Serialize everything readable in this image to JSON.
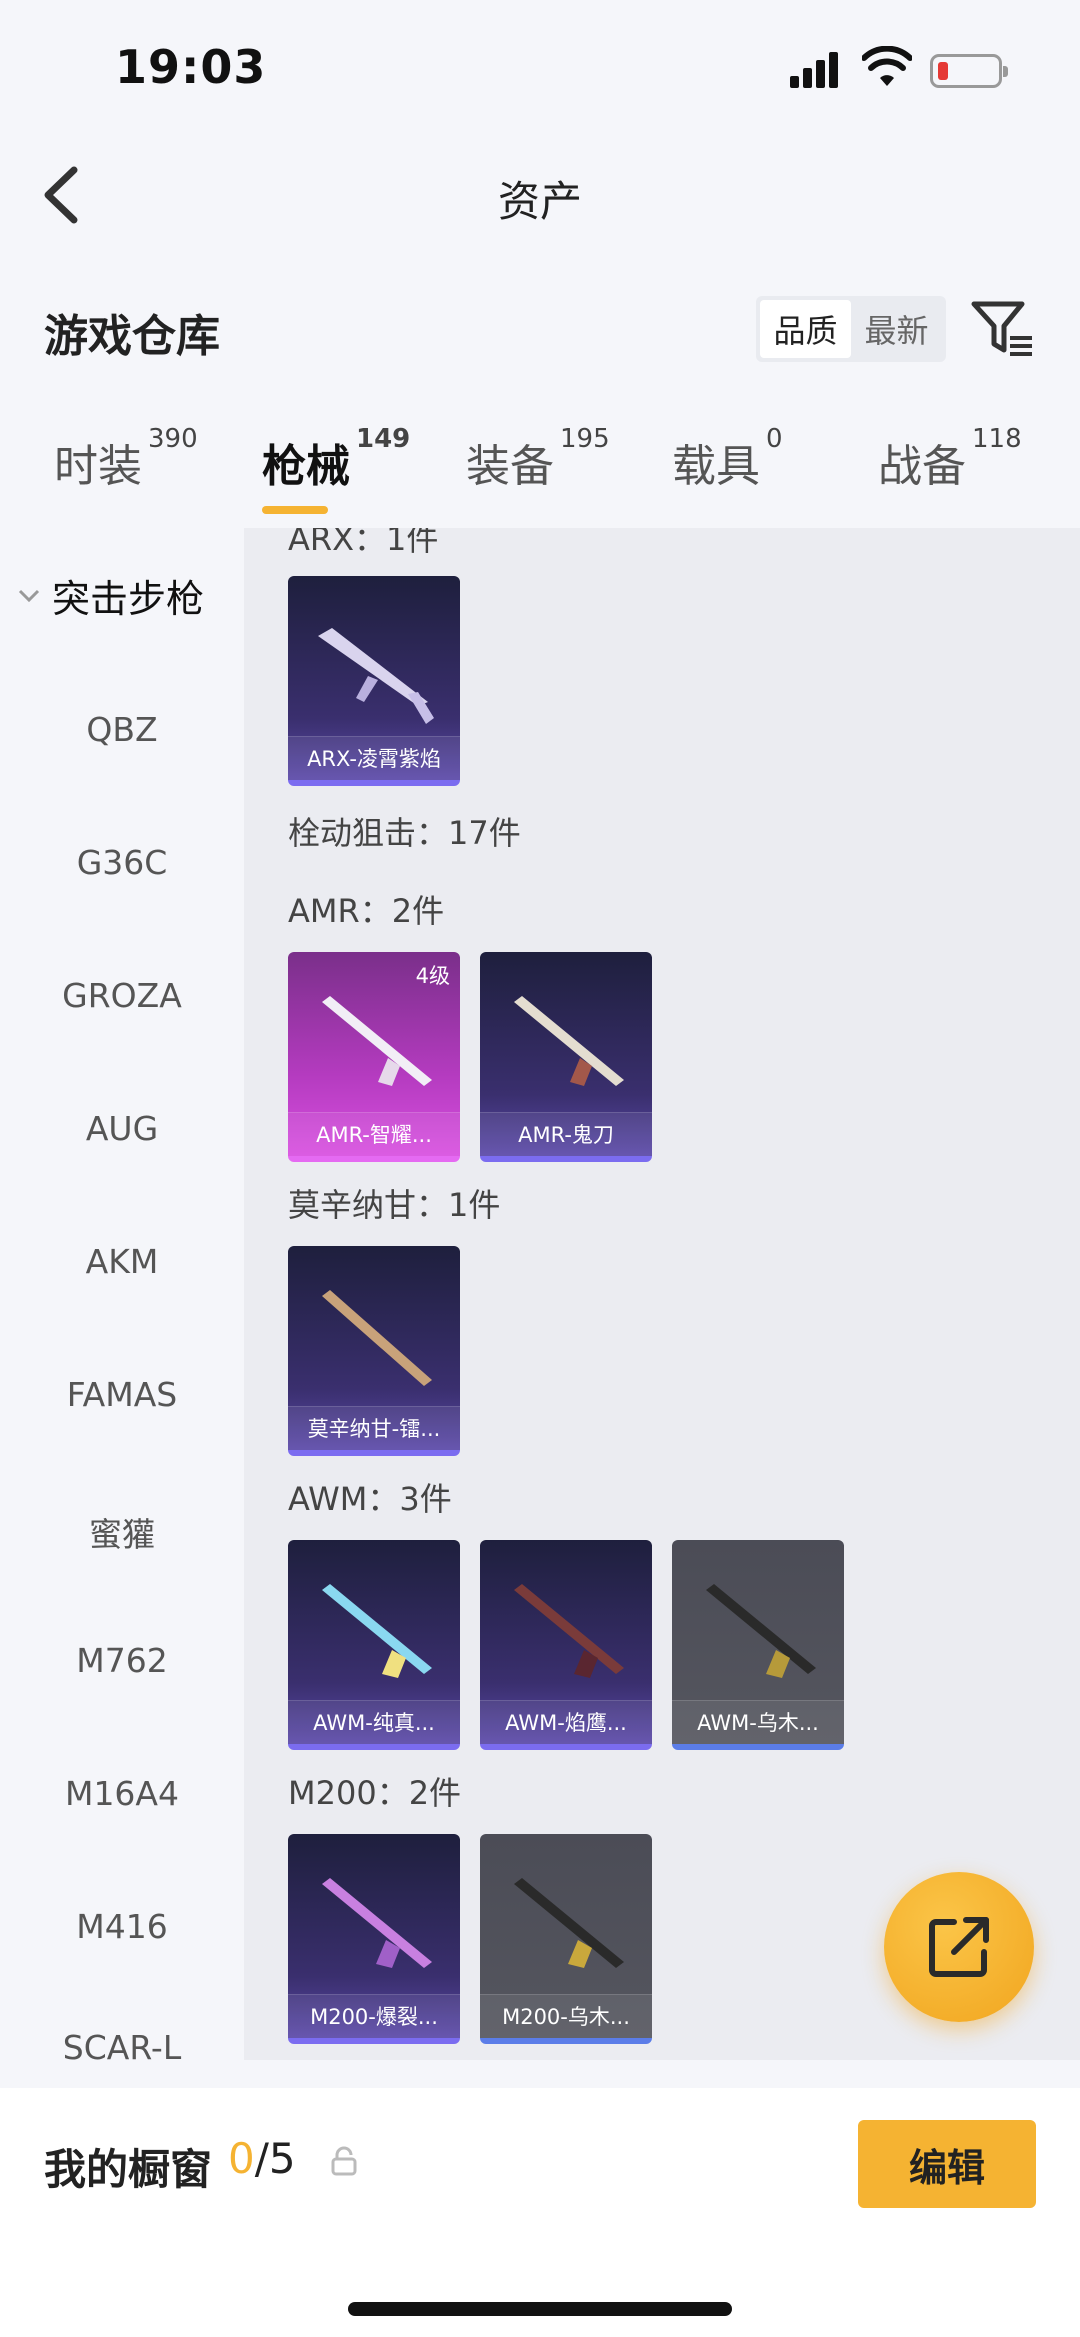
{
  "status": {
    "time": "19:03"
  },
  "nav": {
    "title": "资产"
  },
  "warehouse": {
    "title": "游戏仓库",
    "sort_options": [
      "品质",
      "最新"
    ],
    "sort_active": "品质"
  },
  "tabs": [
    {
      "label": "时装",
      "count": "390"
    },
    {
      "label": "枪械",
      "count": "149",
      "active": true
    },
    {
      "label": "装备",
      "count": "195"
    },
    {
      "label": "载具",
      "count": "0"
    },
    {
      "label": "战备",
      "count": "118"
    }
  ],
  "sidebar": {
    "group": "突击步枪",
    "items": [
      "QBZ",
      "G36C",
      "GROZA",
      "AUG",
      "AKM",
      "FAMAS",
      "蜜獾",
      "M762",
      "M16A4",
      "M416",
      "SCAR-L"
    ]
  },
  "content": {
    "sections": [
      {
        "label": "ARX：1件",
        "cards": [
          {
            "name": "ARX-凌霄紫焰",
            "style": "purple"
          }
        ]
      },
      {
        "label": "栓动狙击：17件",
        "cards": []
      },
      {
        "label": "AMR：2件",
        "cards": [
          {
            "name": "AMR-智耀...",
            "style": "pink",
            "badge": "4级"
          },
          {
            "name": "AMR-鬼刀",
            "style": "purple"
          }
        ]
      },
      {
        "label": "莫辛纳甘：1件",
        "cards": [
          {
            "name": "莫辛纳甘-镭...",
            "style": "purple"
          }
        ]
      },
      {
        "label": "AWM：3件",
        "cards": [
          {
            "name": "AWM-纯真...",
            "style": "purple"
          },
          {
            "name": "AWM-焰鹰...",
            "style": "purple"
          },
          {
            "name": "AWM-乌木...",
            "style": "gray"
          }
        ]
      },
      {
        "label": "M200：2件",
        "cards": [
          {
            "name": "M200-爆裂...",
            "style": "purple"
          },
          {
            "name": "M200-乌木...",
            "style": "gray"
          }
        ]
      }
    ]
  },
  "showcase": {
    "title": "我的橱窗",
    "current": "0",
    "total": "/5",
    "edit_label": "编辑"
  },
  "colors": {
    "accent": "#f5b332",
    "purple_card": "#3a2f6e",
    "pink_card": "#b43bbf",
    "gray_card": "#4b4c56"
  }
}
